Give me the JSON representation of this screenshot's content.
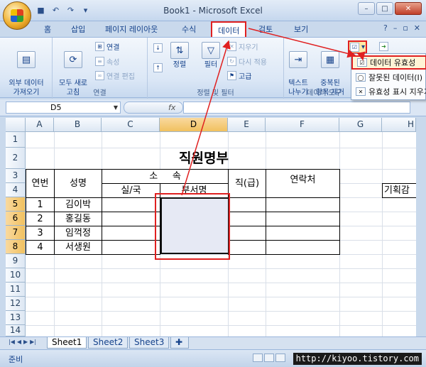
{
  "window": {
    "title": "Book1 - Microsoft Excel",
    "minimize": "–",
    "maximize": "□",
    "close": "✕"
  },
  "qat": {
    "save": "■",
    "undo": "↶",
    "redo": "↷",
    "more": "▾"
  },
  "ribbon_tabs": [
    {
      "label": "홈"
    },
    {
      "label": "삽입"
    },
    {
      "label": "페이지 레이아웃"
    },
    {
      "label": "수식"
    },
    {
      "label": "데이터",
      "active": true
    },
    {
      "label": "검토"
    },
    {
      "label": "보기"
    }
  ],
  "ribbon_right": {
    "help": "?",
    "min": "–",
    "restore": "▫",
    "close": "✕"
  },
  "groups": {
    "external": {
      "label": "외부 데이터\n가져오기"
    },
    "connections": {
      "label": "연결",
      "refresh": "모두 새로\n고침",
      "conn": "연결",
      "props": "속성",
      "edit_links": "연결 편집"
    },
    "sort_filter": {
      "label": "정렬 및 필터",
      "sort": "정렬",
      "filter": "필터",
      "clear": "지우기",
      "reapply": "다시 적용",
      "advanced": "고급"
    },
    "data_tools": {
      "label": "데이터 도구",
      "text_to_cols": "텍스트\n나누기",
      "remove_dup": "중복된\n항목 제거"
    }
  },
  "dropdown": {
    "items": [
      {
        "label": "데이터 유효성",
        "highlight": true
      },
      {
        "label": "잘못된 데이터(I)"
      },
      {
        "label": "유효성 표시 지우기"
      }
    ]
  },
  "formula_bar": {
    "name_box": "D5",
    "fx": "fx",
    "value": ""
  },
  "columns": [
    "A",
    "B",
    "C",
    "D",
    "E",
    "F",
    "G",
    "H"
  ],
  "rows": [
    "1",
    "2",
    "3",
    "4",
    "5",
    "6",
    "7",
    "8",
    "9",
    "10",
    "11",
    "12",
    "13",
    "14"
  ],
  "sheet": {
    "title": "직원명부",
    "header": {
      "no": "연번",
      "name": "성명",
      "dept_group": "소     속",
      "sil_guk": "실/국",
      "busuh": "부서명",
      "rank": "직(급)",
      "contact": "연락처",
      "side_label": "기획감"
    },
    "employees": [
      {
        "no": "1",
        "name": "김이박"
      },
      {
        "no": "2",
        "name": "홍길동"
      },
      {
        "no": "3",
        "name": "임꺽정"
      },
      {
        "no": "4",
        "name": "서생원"
      }
    ]
  },
  "sheet_tabs": [
    {
      "label": "Sheet1",
      "active": true
    },
    {
      "label": "Sheet2"
    },
    {
      "label": "Sheet3"
    }
  ],
  "status": {
    "text": "준비",
    "watermark": "http://kiyoo.tistory.com"
  }
}
